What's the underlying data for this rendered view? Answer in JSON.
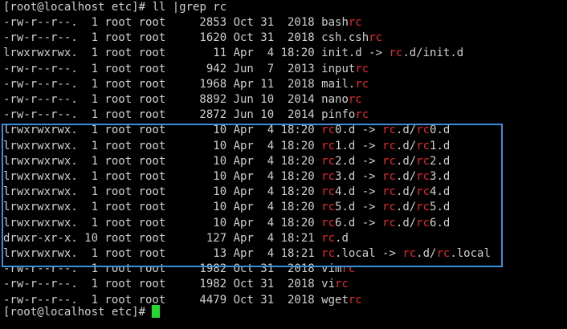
{
  "terminal": {
    "prompt_line": {
      "prompt": "[root@localhost etc]# ",
      "command": "ll |grep rc"
    },
    "highlight_color": "#e8282b",
    "rows": [
      {
        "meta": "-rw-r--r--.  1 root root     2853 Oct 31  2018 ",
        "segments": [
          "bash",
          "@rc"
        ]
      },
      {
        "meta": "-rw-r--r--.  1 root root     1620 Oct 31  2018 ",
        "segments": [
          "csh.csh",
          "@rc"
        ]
      },
      {
        "meta": "lrwxrwxrwx.  1 root root       11 Apr  4 18:20 ",
        "segments": [
          "init.d -> ",
          "@rc",
          ".d/init.d"
        ]
      },
      {
        "meta": "-rw-r--r--.  1 root root      942 Jun  7  2013 ",
        "segments": [
          "input",
          "@rc"
        ]
      },
      {
        "meta": "-rw-r--r--.  1 root root     1968 Apr 11  2018 ",
        "segments": [
          "mail.",
          "@rc"
        ]
      },
      {
        "meta": "-rw-r--r--.  1 root root     8892 Jun 10  2014 ",
        "segments": [
          "nano",
          "@rc"
        ]
      },
      {
        "meta": "-rw-r--r--.  1 root root     2872 Jun 10  2014 ",
        "segments": [
          "pinfo",
          "@rc"
        ]
      },
      {
        "meta": "lrwxrwxrwx.  1 root root       10 Apr  4 18:20 ",
        "segments": [
          "@rc",
          "0.d -> ",
          "@rc",
          ".d/",
          "@rc",
          "0.d"
        ]
      },
      {
        "meta": "lrwxrwxrwx.  1 root root       10 Apr  4 18:20 ",
        "segments": [
          "@rc",
          "1.d -> ",
          "@rc",
          ".d/",
          "@rc",
          "1.d"
        ]
      },
      {
        "meta": "lrwxrwxrwx.  1 root root       10 Apr  4 18:20 ",
        "segments": [
          "@rc",
          "2.d -> ",
          "@rc",
          ".d/",
          "@rc",
          "2.d"
        ]
      },
      {
        "meta": "lrwxrwxrwx.  1 root root       10 Apr  4 18:20 ",
        "segments": [
          "@rc",
          "3.d -> ",
          "@rc",
          ".d/",
          "@rc",
          "3.d"
        ]
      },
      {
        "meta": "lrwxrwxrwx.  1 root root       10 Apr  4 18:20 ",
        "segments": [
          "@rc",
          "4.d -> ",
          "@rc",
          ".d/",
          "@rc",
          "4.d"
        ]
      },
      {
        "meta": "lrwxrwxrwx.  1 root root       10 Apr  4 18:20 ",
        "segments": [
          "@rc",
          "5.d -> ",
          "@rc",
          ".d/",
          "@rc",
          "5.d"
        ]
      },
      {
        "meta": "lrwxrwxrwx.  1 root root       10 Apr  4 18:20 ",
        "segments": [
          "@rc",
          "6.d -> ",
          "@rc",
          ".d/",
          "@rc",
          "6.d"
        ]
      },
      {
        "meta": "drwxr-xr-x. 10 root root      127 Apr  4 18:21 ",
        "segments": [
          "@rc",
          ".d"
        ]
      },
      {
        "meta": "lrwxrwxrwx.  1 root root       13 Apr  4 18:21 ",
        "segments": [
          "@rc",
          ".local -> ",
          "@rc",
          ".d/",
          "@rc",
          ".local"
        ]
      },
      {
        "meta": "-rw-r--r--.  1 root root     1982 Oct 31  2018 ",
        "segments": [
          "vim",
          "@rc"
        ]
      },
      {
        "meta": "-rw-r--r--.  1 root root     1982 Oct 31  2018 ",
        "segments": [
          "vi",
          "@rc"
        ]
      },
      {
        "meta": "-rw-r--r--.  1 root root     4479 Oct 31  2018 ",
        "segments": [
          "wget",
          "@rc"
        ]
      }
    ],
    "final_prompt": "[root@localhost etc]# "
  }
}
